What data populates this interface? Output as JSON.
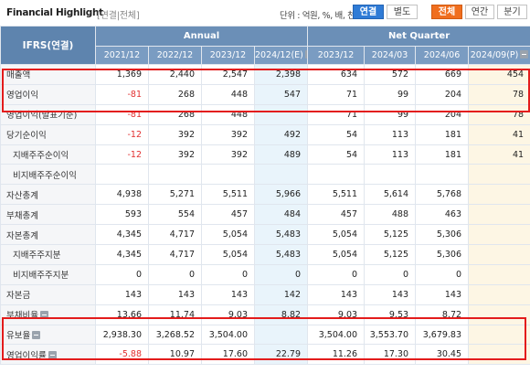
{
  "header": {
    "title": "Financial Highlight",
    "subtitle": "[연결|전체]",
    "unit": "단위 : 억원, %, 배, 천주",
    "buttons": {
      "consolidated": "연결",
      "separate": "별도",
      "all": "전체",
      "annual": "연간",
      "quarter": "분기"
    },
    "active_colors": {
      "consolidated": "#2f7bd6",
      "all": "#f06e1e"
    }
  },
  "table": {
    "corner_label": "IFRS(연결)",
    "group_annual": "Annual",
    "group_quarter": "Net Quarter",
    "columns": [
      "2021/12",
      "2022/12",
      "2023/12",
      "2024/12(E)",
      "2023/12",
      "2024/03",
      "2024/06",
      "2024/09(P)"
    ],
    "rows": [
      {
        "label": "매출액",
        "values": [
          "1,369",
          "2,440",
          "2,547",
          "2,398",
          "634",
          "572",
          "669",
          "454"
        ]
      },
      {
        "label": "영업이익",
        "values": [
          "-81",
          "268",
          "448",
          "547",
          "71",
          "99",
          "204",
          "78"
        ]
      },
      {
        "label": "영업이익(발표기준)",
        "values": [
          "-81",
          "268",
          "448",
          "",
          "71",
          "99",
          "204",
          "78"
        ]
      },
      {
        "label": "당기순이익",
        "values": [
          "-12",
          "392",
          "392",
          "492",
          "54",
          "113",
          "181",
          "41"
        ]
      },
      {
        "label": "지배주주순이익",
        "values": [
          "-12",
          "392",
          "392",
          "489",
          "54",
          "113",
          "181",
          "41"
        ]
      },
      {
        "label": "비지배주주순이익",
        "values": [
          "",
          "",
          "",
          "",
          "",
          "",
          "",
          ""
        ]
      },
      {
        "label": "자산총계",
        "values": [
          "4,938",
          "5,271",
          "5,511",
          "5,966",
          "5,511",
          "5,614",
          "5,768",
          ""
        ]
      },
      {
        "label": "부채총계",
        "values": [
          "593",
          "554",
          "457",
          "484",
          "457",
          "488",
          "463",
          ""
        ]
      },
      {
        "label": "자본총계",
        "values": [
          "4,345",
          "4,717",
          "5,054",
          "5,483",
          "5,054",
          "5,125",
          "5,306",
          ""
        ]
      },
      {
        "label": "지배주주지분",
        "values": [
          "4,345",
          "4,717",
          "5,054",
          "5,483",
          "5,054",
          "5,125",
          "5,306",
          ""
        ]
      },
      {
        "label": "비지배주주지분",
        "values": [
          "0",
          "0",
          "0",
          "0",
          "0",
          "0",
          "0",
          ""
        ]
      },
      {
        "label": "자본금",
        "values": [
          "143",
          "143",
          "143",
          "142",
          "143",
          "143",
          "143",
          ""
        ]
      },
      {
        "label": "부채비율",
        "values": [
          "13.66",
          "11.74",
          "9.03",
          "8.82",
          "9.03",
          "9.53",
          "8.72",
          ""
        ]
      },
      {
        "label": "유보율",
        "values": [
          "2,938.30",
          "3,268.52",
          "3,504.00",
          "",
          "3,504.00",
          "3,553.70",
          "3,679.83",
          ""
        ]
      },
      {
        "label": "영업이익률",
        "values": [
          "-5.88",
          "10.97",
          "17.60",
          "22.79",
          "11.26",
          "17.30",
          "30.45",
          ""
        ]
      }
    ]
  }
}
